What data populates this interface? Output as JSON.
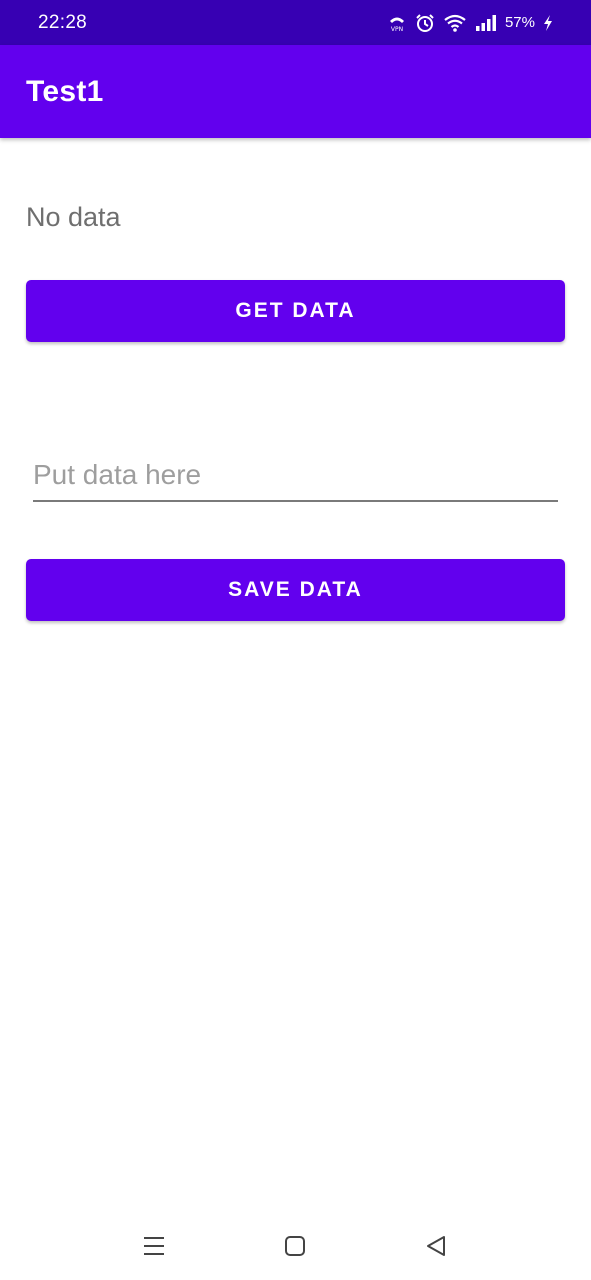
{
  "status_bar": {
    "time": "22:28",
    "battery": "57%",
    "icons": [
      "vpn-icon",
      "alarm-icon",
      "wifi-icon",
      "signal-icon",
      "charging-icon"
    ]
  },
  "app_bar": {
    "title": "Test1",
    "color": "#6200ee"
  },
  "main": {
    "data_text": "No data",
    "get_button_label": "GET DATA",
    "input": {
      "value": "",
      "placeholder": "Put data here"
    },
    "save_button_label": "SAVE DATA"
  },
  "nav_bar": {
    "buttons": [
      "recents-icon",
      "home-icon",
      "back-icon"
    ]
  },
  "colors": {
    "status_bar": "#3700b3",
    "primary": "#6200ee",
    "on_primary": "#ffffff"
  }
}
